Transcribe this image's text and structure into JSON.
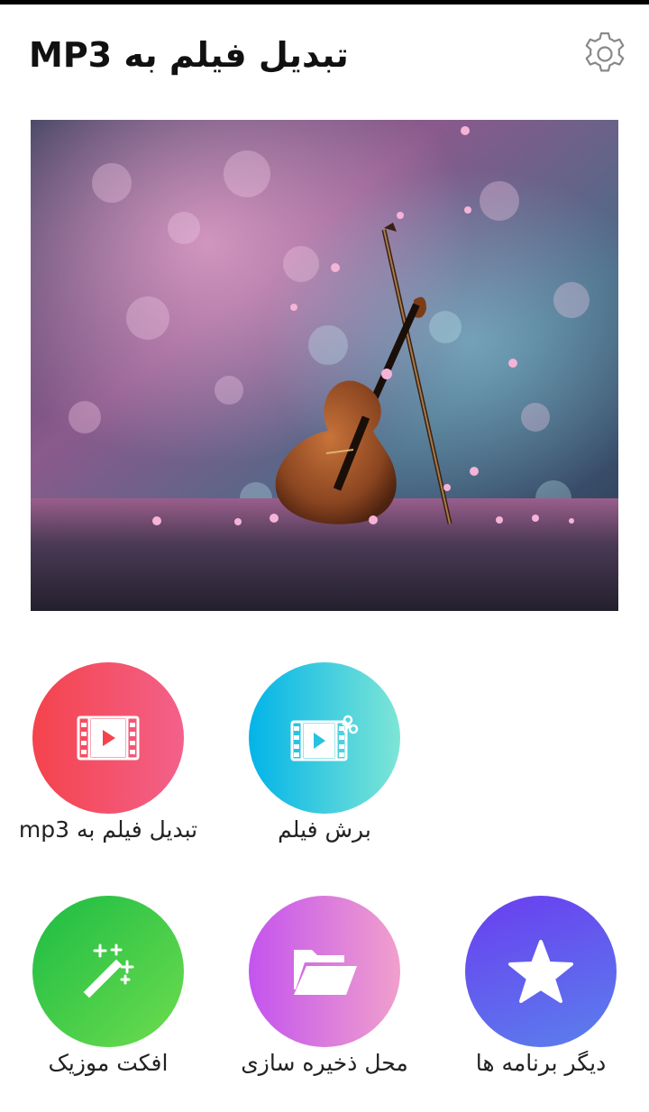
{
  "header": {
    "title": "تبدیل فیلم به MP3",
    "settings_icon": "gear-icon"
  },
  "hero": {
    "image": "violin-with-blossoms-photo"
  },
  "tiles": [
    {
      "label": "تبدیل فیلم به mp3",
      "icon": "video-play-icon",
      "color": "#f4434c"
    },
    {
      "label": "برش فیلم",
      "icon": "video-cut-icon",
      "color": "#02b4e8"
    },
    {
      "label": "افکت موزیک",
      "icon": "magic-wand-icon",
      "color": "#1cbc44"
    },
    {
      "label": "محل ذخیره سازی",
      "icon": "folder-open-icon",
      "color": "#c454ee"
    },
    {
      "label": "دیگر برنامه ها",
      "icon": "star-icon",
      "color": "#6a3df0"
    }
  ]
}
